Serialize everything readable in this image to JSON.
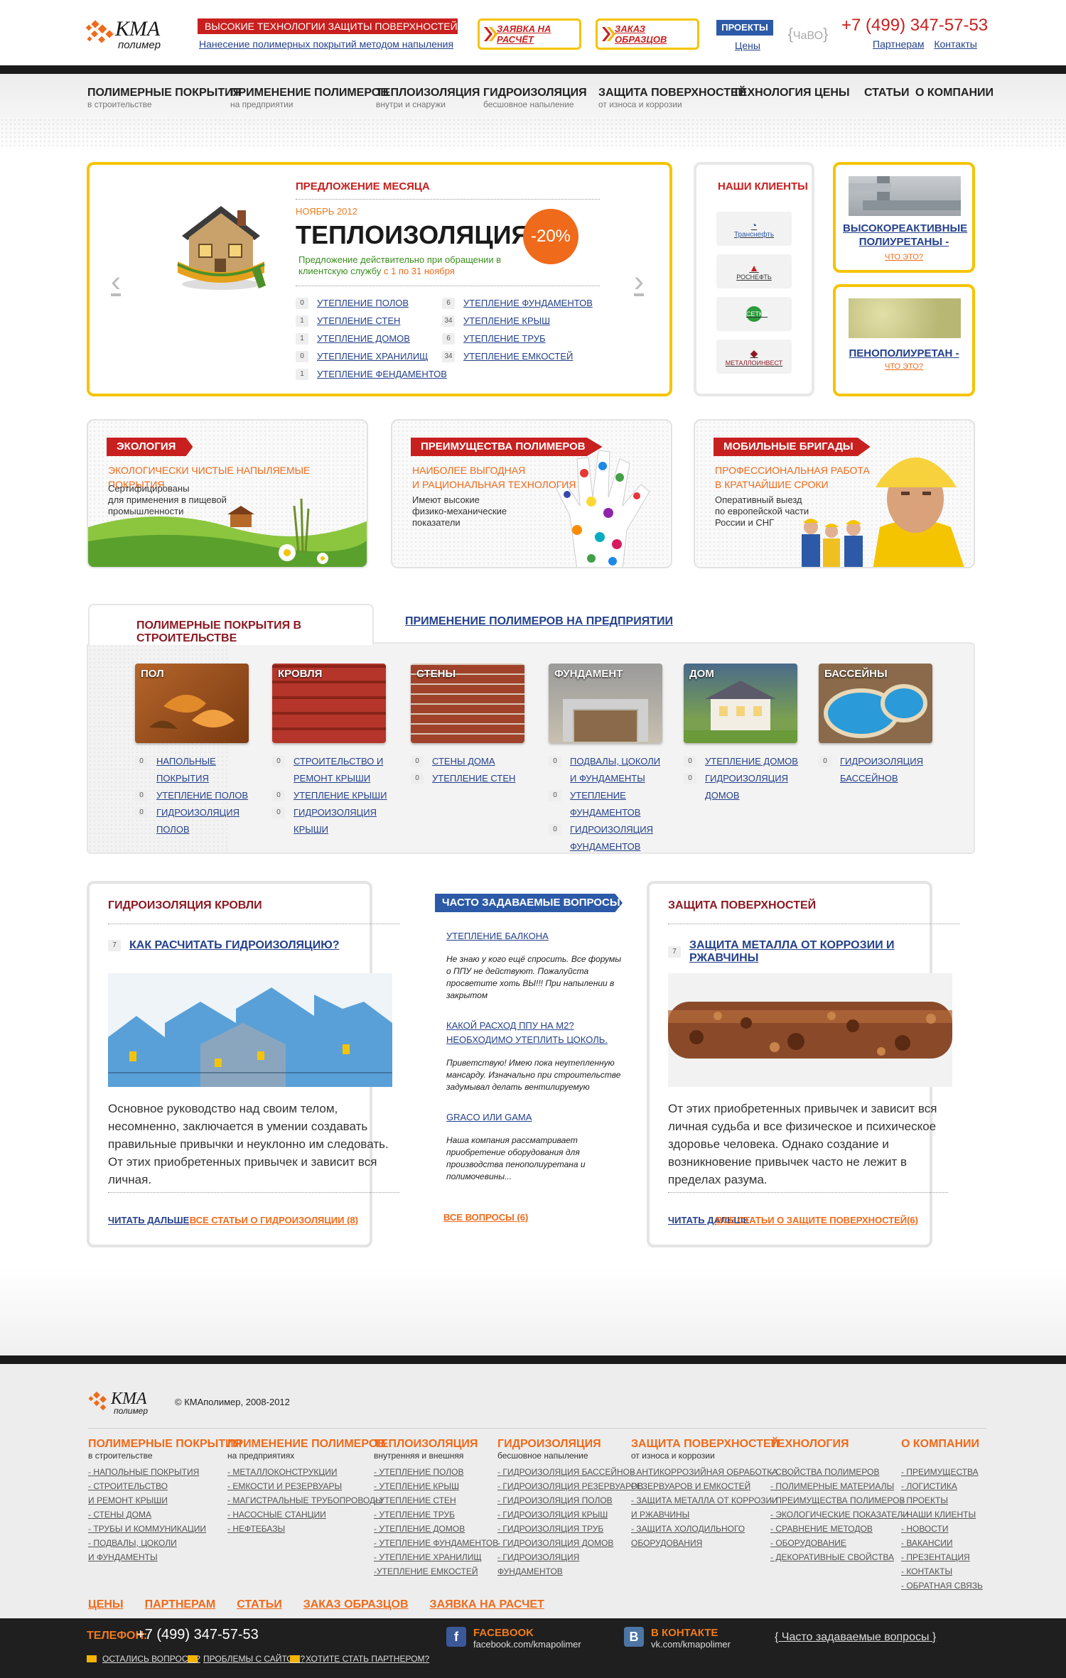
{
  "header": {
    "logo_text": "КМА",
    "logo_sub": "полимер",
    "tagline": "ВЫСОКИЕ ТЕХНОЛОГИИ ЗАЩИТЫ ПОВЕРХНОСТЕЙ",
    "subtagline": "Нанесение полимерных покрытий методом напыления",
    "btn_calc": "ЗАЯВКА НА РАСЧЁТ",
    "btn_samples": "ЗАКАЗ ОБРАЗЦОВ",
    "projects": "ПРОЕКТЫ",
    "prices": "Цены",
    "faq_short": "ЧаВО",
    "phone": "+7 (499) 347-57-53",
    "partners": "Партнерам",
    "contacts": "Контакты"
  },
  "nav": [
    {
      "title": "ПОЛИМЕРНЫЕ ПОКРЫТИЯ",
      "sub": "в строительстве"
    },
    {
      "title": "ПРИМЕНЕНИЕ ПОЛИМЕРОВ",
      "sub": "на предприятии"
    },
    {
      "title": "ТЕПЛОИЗОЛЯЦИЯ",
      "sub": "внутри и снаружи"
    },
    {
      "title": "ГИДРОИЗОЛЯЦИЯ",
      "sub": "бесшовное напыление"
    },
    {
      "title": "ЗАЩИТА ПОВЕРХНОСТЕЙ",
      "sub": "от износа и коррозии"
    },
    {
      "title": "ТЕХНОЛОГИЯ",
      "sub": ""
    },
    {
      "title": "ЦЕНЫ",
      "sub": ""
    },
    {
      "title": "СТАТЬИ",
      "sub": ""
    },
    {
      "title": "О КОМПАНИИ",
      "sub": ""
    }
  ],
  "offer": {
    "label": "ПРЕДЛОЖЕНИЕ МЕСЯЦА",
    "date": "НОЯБРЬ 2012",
    "title": "ТЕПЛОИЗОЛЯЦИЯ",
    "badge": "-20%",
    "note": "Предложение действительно при обращении в клиентскую службу",
    "note_hl": "с 1 по 31 ноября",
    "col1": [
      {
        "count": "0",
        "label": "УТЕПЛЕНИЕ ПОЛОВ"
      },
      {
        "count": "1",
        "label": "УТЕПЛЕНИЕ СТЕН"
      },
      {
        "count": "1",
        "label": "УТЕПЛЕНИЕ ДОМОВ"
      },
      {
        "count": "0",
        "label": "УТЕПЛЕНИЕ ХРАНИЛИЩ"
      },
      {
        "count": "1",
        "label": "УТЕПЛЕНИЕ ФЕНДАМЕНТОВ"
      }
    ],
    "col2": [
      {
        "count": "6",
        "label": "УТЕПЛЕНИЕ ФУНДАМЕНТОВ"
      },
      {
        "count": "34",
        "label": "УТЕПЛЕНИЕ КРЫШ"
      },
      {
        "count": "6",
        "label": "УТЕПЛЕНИЕ ТРУБ"
      },
      {
        "count": "34",
        "label": "УТЕПЛЕНИЕ ЕМКОСТЕЙ"
      }
    ]
  },
  "clients": {
    "title": "НАШИ КЛИЕНТЫ",
    "items": [
      "Транснефть",
      "РОСНЕФТЬ",
      "СЕТКО",
      "МЕТАЛЛОИНВЕСТ"
    ]
  },
  "side": [
    {
      "label": "ВЫСОКОРЕАКТИВНЫЕ ПОЛИУРЕТАНЫ -",
      "q": "ЧТО ЭТО?"
    },
    {
      "label": "ПЕНОПОЛИУРЕТАН -",
      "q": "ЧТО ЭТО?"
    }
  ],
  "promos": [
    {
      "tab": "ЭКОЛОГИЯ",
      "head": "ЭКОЛОГИЧЕСКИ ЧИСТЫЕ НАПЫЛЯЕМЫЕ ПОКРЫТИЯ",
      "body": "Сертифицированы\nдля применения в пищевой\nпромышленности"
    },
    {
      "tab": "ПРЕИМУЩЕСТВА ПОЛИМЕРОВ",
      "head": "НАИБОЛЕЕ ВЫГОДНАЯ\nИ РАЦИОНАЛЬНАЯ ТЕХНОЛОГИЯ",
      "body": "Имеют высокие\nфизико-механические\nпоказатели"
    },
    {
      "tab": "МОБИЛЬНЫЕ БРИГАДЫ",
      "head": "ПРОФЕССИОНАЛЬНАЯ РАБОТА\nВ КРАТЧАЙШИЕ СРОКИ",
      "body": "Оперативный выезд\nпо европейской части\nРоссии и СНГ"
    }
  ],
  "tabs": {
    "active": "ПОЛИМЕРНЫЕ ПОКРЫТИЯ В СТРОИТЕЛЬСТВЕ",
    "inactive": "ПРИМЕНЕНИЕ ПОЛИМЕРОВ НА ПРЕДПРИЯТИИ",
    "cats": [
      {
        "name": "ПОЛ",
        "links": [
          {
            "count": "0",
            "label": "НАПОЛЬНЫЕ ПОКРЫТИЯ"
          },
          {
            "count": "0",
            "label": "УТЕПЛЕНИЕ ПОЛОВ"
          },
          {
            "count": "0",
            "label": "ГИДРОИЗОЛЯЦИЯ ПОЛОВ"
          }
        ]
      },
      {
        "name": "КРОВЛЯ",
        "links": [
          {
            "count": "0",
            "label": "СТРОИТЕЛЬСТВО И РЕМОНТ КРЫШИ"
          },
          {
            "count": "0",
            "label": "УТЕПЛЕНИЕ КРЫШИ"
          },
          {
            "count": "0",
            "label": "ГИДРОИЗОЛЯЦИЯ КРЫШИ"
          }
        ]
      },
      {
        "name": "СТЕНЫ",
        "links": [
          {
            "count": "0",
            "label": "СТЕНЫ ДОМА"
          },
          {
            "count": "0",
            "label": "УТЕПЛЕНИЕ СТЕН"
          }
        ]
      },
      {
        "name": "ФУНДАМЕНТ",
        "links": [
          {
            "count": "0",
            "label": "ПОДВАЛЫ, ЦОКОЛИ И ФУНДАМЕНТЫ"
          },
          {
            "count": "0",
            "label": "УТЕПЛЕНИЕ ФУНДАМЕНТОВ"
          },
          {
            "count": "0",
            "label": "ГИДРОИЗОЛЯЦИЯ ФУНДАМЕНТОВ"
          }
        ]
      },
      {
        "name": "ДОМ",
        "links": [
          {
            "count": "0",
            "label": "УТЕПЛЕНИЕ ДОМОВ"
          },
          {
            "count": "0",
            "label": "ГИДРОИЗОЛЯЦИЯ ДОМОВ"
          }
        ]
      },
      {
        "name": "БАССЕЙНЫ",
        "links": [
          {
            "count": "0",
            "label": "ГИДРОИЗОЛЯЦИЯ БАССЕЙНОВ"
          }
        ]
      }
    ]
  },
  "panel_left": {
    "title": "ГИДРОИЗОЛЯЦИЯ КРОВЛИ",
    "count": "7",
    "question": "КАК РАСЧИТАТЬ ГИДРОИЗОЛЯЦИЮ?",
    "text": "Основное руководство над своим телом, несомненно, заключается в умении создавать правильные привычки и неуклонно им следовать. От этих приобретенных привычек и зависит вся личная.",
    "more": "ЧИТАТЬ ДАЛЬШЕ",
    "all": "ВСЕ СТАТЬИ О ГИДРОИЗОЛЯЦИИ (8)"
  },
  "faq": {
    "title": "ЧАСТО ЗАДАВАЕМЫЕ ВОПРОСЫ",
    "items": [
      {
        "q": "УТЕПЛЕНИЕ БАЛКОНА",
        "a": "Не знаю у кого ещё спросить. Все форумы о ППУ не действуют. Пожалуйста просветите хоть ВЫ!!! При напылении в закрытом"
      },
      {
        "q": "КАКОЙ РАСХОД ППУ НА М2? НЕОБХОДИМО УТЕПЛИТЬ ЦОКОЛЬ.",
        "a": "Приветствую! Имею пока неутепленную мансарду. Изначально при строительстве задумывал делать вентилируемую"
      },
      {
        "q": "GRACO ИЛИ GAMA",
        "a": "Наша компания рассматривает приобретение оборудования для производства пенополиуретана и полимочевины..."
      }
    ],
    "all": "ВСЕ ВОПРОСЫ (6)"
  },
  "panel_right": {
    "title": "ЗАЩИТА ПОВЕРХНОСТЕЙ",
    "count": "7",
    "question": "ЗАЩИТА МЕТАЛЛА ОТ КОРРОЗИИ И РЖАВЧИНЫ",
    "text": "От этих приобретенных привычек и зависит вся личная судьба и все физическое и психическое здоровье человека. Однако создание и возникновение привычек часто не лежит в пределах разума.",
    "more": "ЧИТАТЬ ДАЛЬШЕ",
    "all": "ВСЕ СТАТЬИ О ЗАЩИТЕ ПОВЕРХНОСТЕЙ(6)"
  },
  "footer": {
    "copyright": "© КМАполимер, 2008-2012",
    "cols": [
      {
        "title": "ПОЛИМЕРНЫЕ ПОКРЫТИЯ",
        "sub": "в строительстве",
        "links": [
          "- НАПОЛЬНЫЕ ПОКРЫТИЯ",
          "- СТРОИТЕЛЬСТВО",
          "И РЕМОНТ КРЫШИ",
          "- СТЕНЫ ДОМА",
          "- ТРУБЫ И КОММУНИКАЦИИ",
          "- ПОДВАЛЫ, ЦОКОЛИ",
          "И ФУНДАМЕНТЫ"
        ]
      },
      {
        "title": "ПРИМЕНЕНИЕ ПОЛИМЕРОВ",
        "sub": "на предприятиях",
        "links": [
          "- МЕТАЛЛОКОНСТРУКЦИИ",
          "- ЕМКОСТИ И РЕЗЕРВУАРЫ",
          "- МАГИСТРАЛЬНЫЕ ТРУБОПРОВОДЫ",
          "- НАСОСНЫЕ СТАНЦИИ",
          "- НЕФТЕБАЗЫ"
        ]
      },
      {
        "title": "ТЕПЛОИЗОЛЯЦИЯ",
        "sub": "внутренняя и внешняя",
        "links": [
          "- УТЕПЛЕНИЕ ПОЛОВ",
          "- УТЕПЛЕНИЕ КРЫШ",
          "- УТЕПЛЕНИЕ СТЕН",
          "- УТЕПЛЕНИЕ ТРУБ",
          "- УТЕПЛЕНИЕ ДОМОВ",
          "- УТЕПЛЕНИЕ ФУНДАМЕНТОВ",
          "- УТЕПЛЕНИЕ ХРАНИЛИЩ",
          "-УТЕПЛЕНИЕ ЕМКОСТЕЙ"
        ]
      },
      {
        "title": "ГИДРОИЗОЛЯЦИЯ",
        "sub": "бесшовное напыление",
        "links": [
          "- ГИДРОИЗОЛЯЦИЯ БАССЕЙНОВ",
          "- ГИДРОИЗОЛЯЦИЯ РЕЗЕРВУАРОВ",
          "- ГИДРОИЗОЛЯЦИЯ ПОЛОВ",
          "- ГИДРОИЗОЛЯЦИЯ КРЫШ",
          "- ГИДРОИЗОЛЯЦИЯ ТРУБ",
          "- ГИДРОИЗОЛЯЦИЯ ДОМОВ",
          "- ГИДРОИЗОЛЯЦИЯ",
          "ФУНДАМЕНТОВ"
        ]
      },
      {
        "title": "ЗАЩИТА ПОВЕРХНОСТЕЙ",
        "sub": "от износа и коррозии",
        "links": [
          "- АНТИКОРРОЗИЙНАЯ ОБРАБОТКА",
          "РЕЗЕРВУАРОВ И ЕМКОСТЕЙ",
          "- ЗАЩИТА МЕТАЛЛА ОТ КОРРОЗИИ",
          "И РЖАВЧИНЫ",
          "- ЗАЩИТА ХОЛОДИЛЬНОГО",
          "ОБОРУДОВАНИЯ"
        ]
      },
      {
        "title": "ТЕХНОЛОГИЯ",
        "sub": "",
        "links": [
          "- СВОЙСТВА ПОЛИМЕРОВ",
          "- ПОЛИМЕРНЫЕ МАТЕРИАЛЫ",
          "- ПРЕИМУЩЕСТВА ПОЛИМЕРОВ",
          "- ЭКОЛОГИЧЕСКИЕ ПОКАЗАТЕЛИ",
          "- СРАВНЕНИЕ МЕТОДОВ",
          "- ОБОРУДОВАНИЕ",
          "- ДЕКОРАТИВНЫЕ СВОЙСТВА"
        ]
      },
      {
        "title": "О КОМПАНИИ",
        "sub": "",
        "links": [
          "- ПРЕИМУЩЕСТВА",
          "- ЛОГИСТИКА",
          "- ПРОЕКТЫ",
          "- НАШИ КЛИЕНТЫ",
          "- НОВОСТИ",
          "- ВАКАНСИИ",
          "- ПРЕЗЕНТАЦИЯ",
          "- КОНТАКТЫ",
          "- ОБРАТНАЯ СВЯЗЬ"
        ]
      }
    ],
    "bottom_links": [
      "ЦЕНЫ",
      "ПАРТНЕРАМ",
      "СТАТЬИ",
      "ЗАКАЗ ОБРАЗЦОВ",
      "ЗАЯВКА НА РАСЧЕТ"
    ],
    "phone_label": "ТЕЛЕФОН:",
    "phone": "+7 (499) 347-57-53",
    "small_links": [
      "ОСТАЛИСЬ ВОПРОСЫ?",
      "ПРОБЛЕМЫ С САЙТОМ?",
      "ХОТИТЕ СТАТЬ ПАРТНЕРОМ?"
    ],
    "facebook_name": "FACEBOOK",
    "facebook_url": "facebook.com/kmapolimer",
    "vk_name": "В КОНТАКТЕ",
    "vk_url": "vk.com/kmapolimer",
    "faq_link": "Часто задаваемые вопросы"
  },
  "colors": {
    "accent_red": "#c8201e",
    "accent_orange": "#ef6a1a",
    "accent_yellow": "#f5c400",
    "link_blue": "#24418c"
  }
}
